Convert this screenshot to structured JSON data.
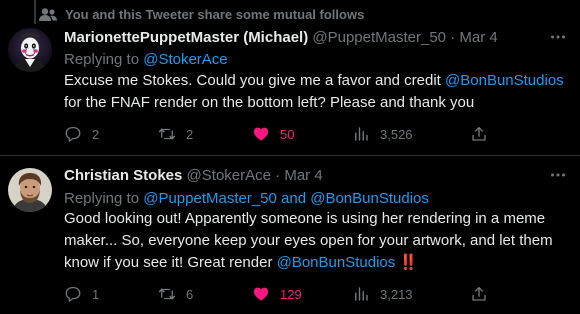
{
  "context_label": "You and this Tweeter share some mutual follows",
  "tweets": [
    {
      "name": "MarionettePuppetMaster (Michael)",
      "handle": "@PuppetMaster_50",
      "dot": "·",
      "date": "Mar 4",
      "replying_prefix": "Replying to ",
      "replying_to": "@StokerAce",
      "replying_and": "",
      "replying_to2": "",
      "body_1": "Excuse me Stokes. Could you give me a favor and credit ",
      "body_mention": "@BonBunStudios",
      "body_2": " for the FNAF render on the bottom left? Please and thank you",
      "replies": "2",
      "retweets": "2",
      "likes": "50",
      "views": "3,526",
      "avatar_icon": "puppet-avatar"
    },
    {
      "name": "Christian Stokes",
      "handle": "@StokerAce",
      "dot": "·",
      "date": "Mar 4",
      "replying_prefix": "Replying to ",
      "replying_to": "@PuppetMaster_50",
      "replying_and": " and ",
      "replying_to2": "@BonBunStudios",
      "body_1": "Good looking out! Apparently someone is using her rendering in a meme maker... So, everyone keep your eyes open for your artwork, and let them know if you see it! Great render ",
      "body_mention": "@BonBunStudios",
      "body_2": " ‼️",
      "replies": "1",
      "retweets": "6",
      "likes": "129",
      "views": "3,213",
      "avatar_icon": "man-avatar"
    }
  ],
  "colors": {
    "background": "#000000",
    "text": "#e7e9ea",
    "muted": "#71767b",
    "link": "#1d9bf0",
    "like": "#f91880"
  }
}
